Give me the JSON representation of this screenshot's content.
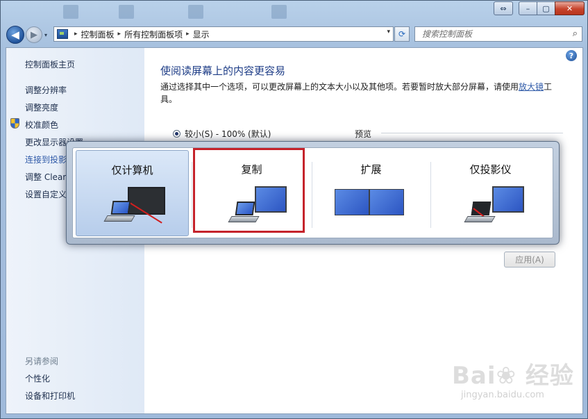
{
  "window": {
    "extra_glyph": "⇔",
    "min_glyph": "–",
    "max_glyph": "▢",
    "close_glyph": "✕"
  },
  "nav": {
    "back_glyph": "◀",
    "forward_glyph": "▶",
    "history_glyph": "▾",
    "breadcrumb": [
      "控制面板",
      "所有控制面板项",
      "显示"
    ],
    "crumb_sep": "▸",
    "dropdown_glyph": "▾",
    "refresh_glyph": "⟳",
    "search_placeholder": "搜索控制面板",
    "search_glyph": "⌕"
  },
  "sidebar": {
    "home": "控制面板主页",
    "links": [
      "调整分辨率",
      "调整亮度",
      "校准颜色",
      "更改显示器设置",
      "连接到投影仪",
      "调整 ClearType 文本",
      "设置自定义文本大小(DPI)"
    ],
    "see_also_title": "另请参阅",
    "see_also": [
      "个性化",
      "设备和打印机"
    ]
  },
  "main": {
    "title": "使阅读屏幕上的内容更容易",
    "desc_before": "通过选择其中一个选项，可以更改屏幕上的文本大小以及其他项。若要暂时放大部分屏幕，请使用",
    "desc_link": "放大镜",
    "desc_after": "工具。",
    "help_glyph": "?",
    "option_small": "较小(S) - 100% (默认)",
    "preview_label": "预览",
    "apply_label": "应用(A)"
  },
  "switcher": {
    "options": [
      {
        "label": "仅计算机",
        "selected": true
      },
      {
        "label": "复制",
        "selected": false
      },
      {
        "label": "扩展",
        "selected": false
      },
      {
        "label": "仅投影仪",
        "selected": false
      }
    ]
  },
  "watermark": {
    "main": "Bai❀ 经验",
    "sub": "jingyan.baidu.com"
  },
  "colors": {
    "highlight": "#c5232b",
    "link": "#2f5aa8",
    "title": "#1e3d87"
  }
}
